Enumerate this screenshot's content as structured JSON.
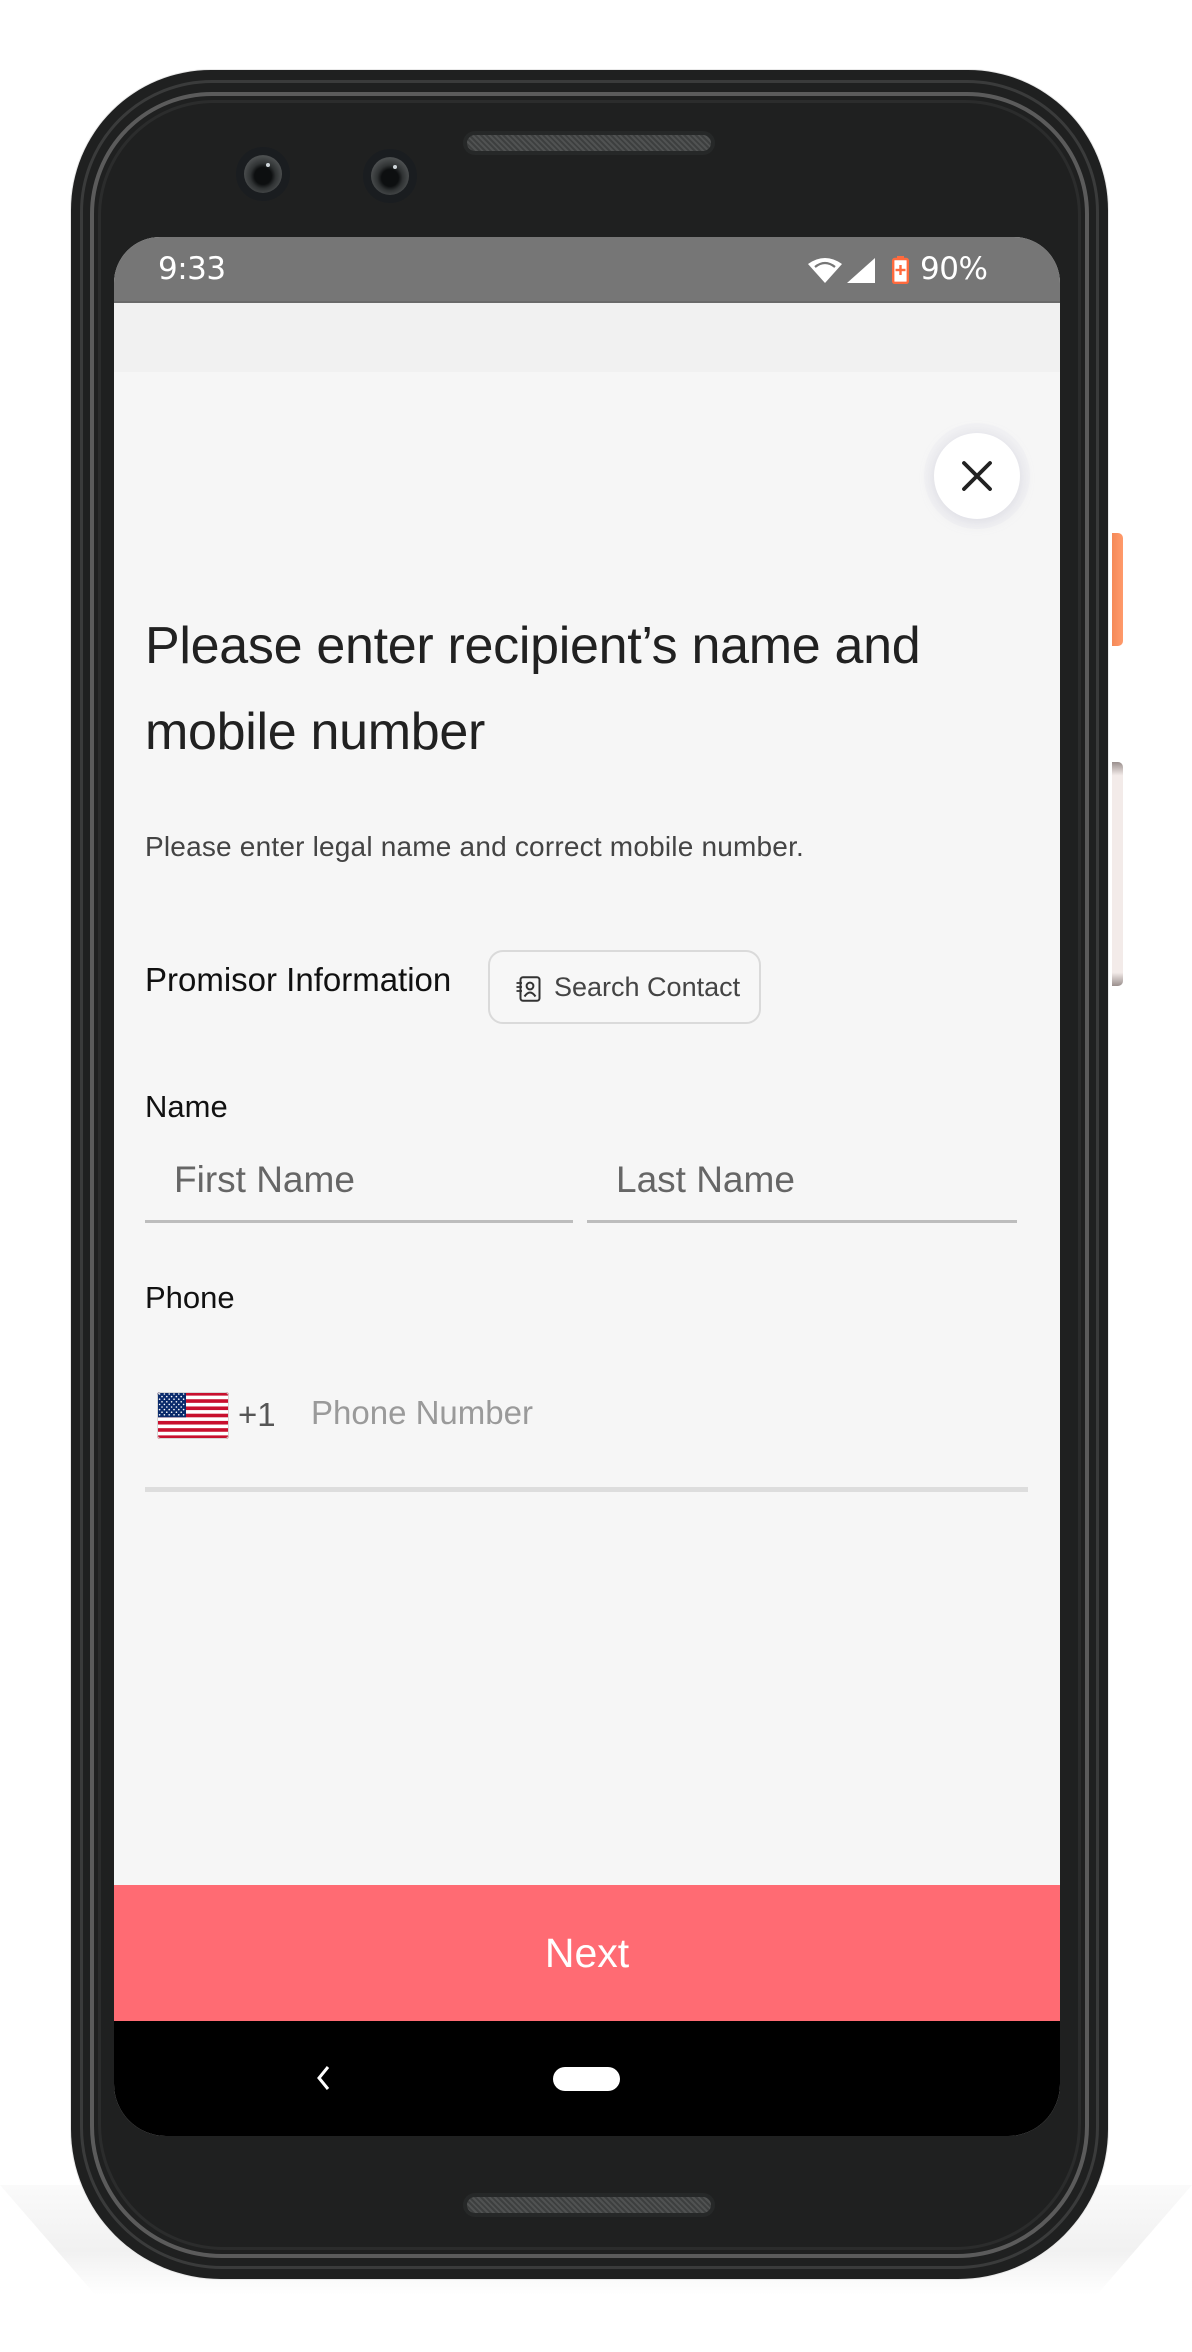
{
  "device": {
    "model": "android-phone-frame",
    "accent_button_colors": {
      "power": "#FF9566",
      "volume": "#F3EBE9"
    }
  },
  "status_bar": {
    "time": "9:33",
    "battery_percent": "90%",
    "battery_level": 0.9,
    "icons": [
      "wifi-icon",
      "cellular-signal-icon",
      "battery-charging-icon"
    ],
    "battery_color": "#FF6A3D",
    "background": "#767676"
  },
  "close_button": {
    "icon": "close-icon",
    "label": "Close"
  },
  "page": {
    "headline": "Please enter recipient’s name and mobile number",
    "subtitle": "Please enter legal name and correct mobile number."
  },
  "promisor": {
    "section_label": "Promisor Information",
    "search_contact_label": "Search Contact",
    "search_contact_icon": "contact-book-icon"
  },
  "name": {
    "label": "Name",
    "first_name": {
      "value": "",
      "placeholder": "First Name"
    },
    "last_name": {
      "value": "",
      "placeholder": "Last Name"
    }
  },
  "phone": {
    "label": "Phone",
    "country_flag": "us-flag-icon",
    "country_code": "+1",
    "number": {
      "value": "",
      "placeholder": "Phone Number"
    }
  },
  "footer": {
    "next_label": "Next",
    "next_color": "#FF6B73"
  },
  "nav_bar": {
    "buttons": [
      "back",
      "home"
    ]
  }
}
